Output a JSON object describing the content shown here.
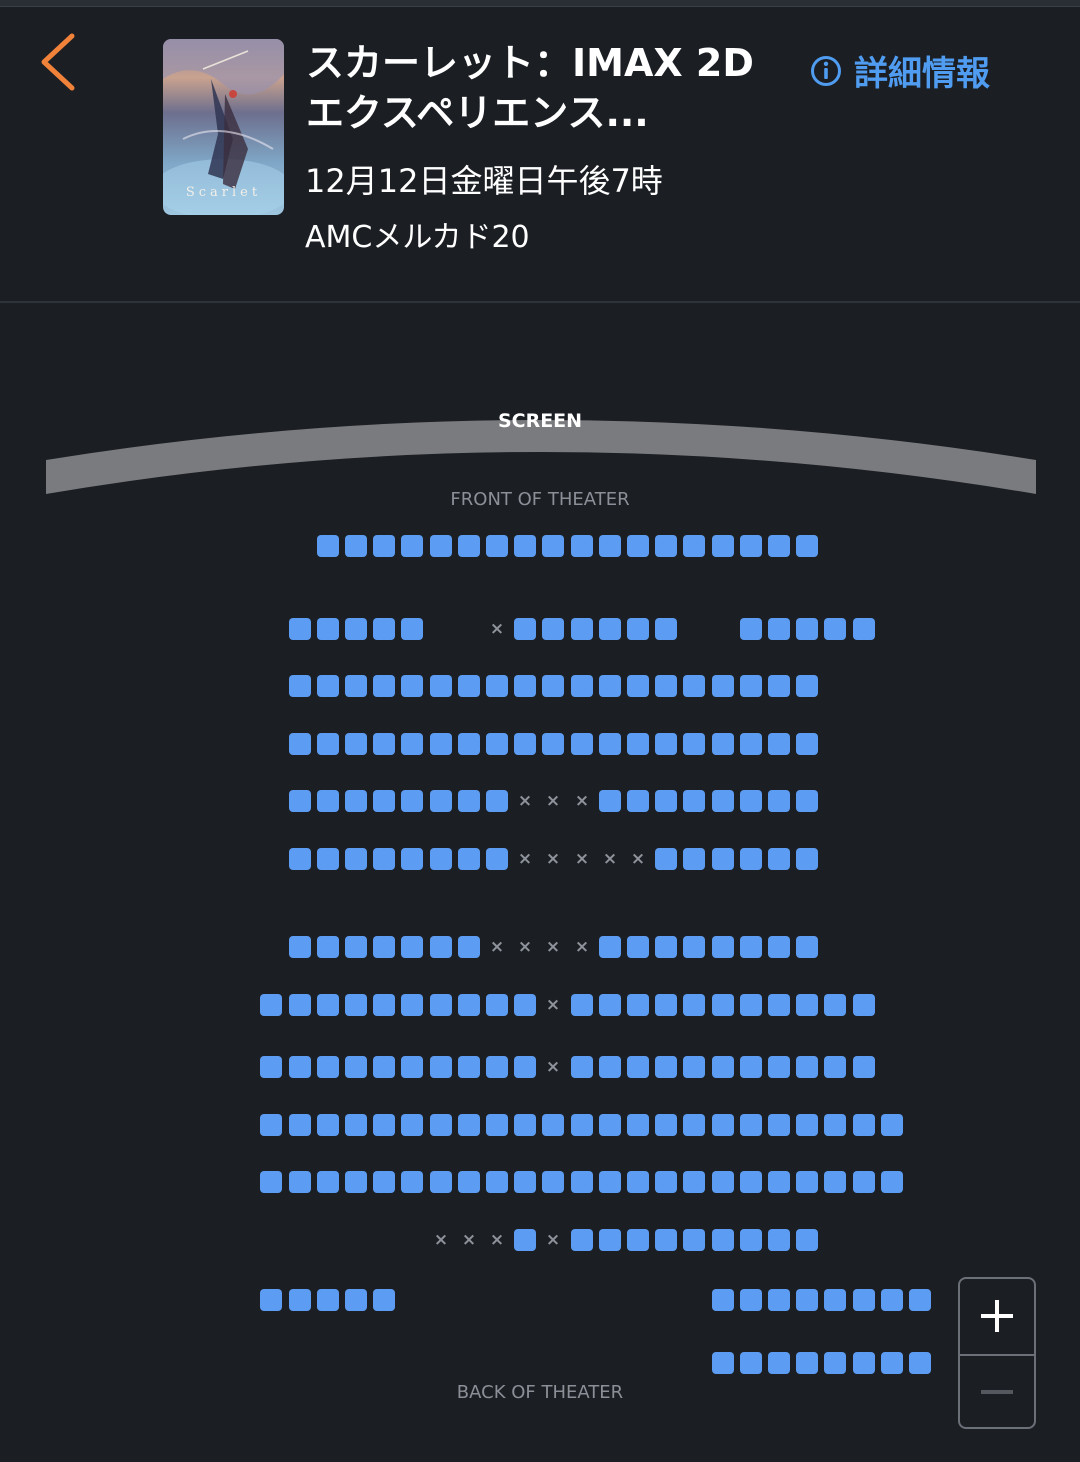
{
  "header": {
    "title_line1": "スカーレット：IMAX 2D",
    "title_line2": "エクスペリエンス...",
    "showtime": "12月12日金曜日午後7時",
    "venue": "AMCメルカド20",
    "details_label": "詳細情報",
    "poster_alt": "Scarlet"
  },
  "auditorium": {
    "screen_label": "SCREEN",
    "front_label": "FRONT OF THEATER",
    "back_label": "BACK OF THEATER",
    "legend": {
      "available": "#5d9cf3",
      "unavailable": "×"
    }
  },
  "seat_rows": [
    "....SSSSSSSSSSSSSSSSSS....",
    "...SSSSS..XSSSSSS..SSSSS..",
    "...SSSSSSSSSSSSSSSSSSS....",
    "...SSSSSSSSSSSSSSSSSSS....",
    "...SSSSSSSSXXXSSSSSSSS....",
    "...SSSSSSSSXXXXXSSSSSS....",
    "...SSSSSSSXXXXSSSSSSSS....",
    "..SSSSSSSSSSXSSSSSSSSSSS..",
    "..SSSSSSSSSSXSSSSSSSSSSS..",
    "..SSSSSSSSSSSSSSSSSSSSSSS.",
    "..SSSSSSSSSSSSSSSSSSSSSSS.",
    "........XXXSXSSSSSSSSS....",
    "..SSSSS...........SSSSSSSS",
    "..................SSSSSSSS"
  ],
  "zoom": {
    "in_icon": "plus-icon",
    "out_icon": "minus-icon"
  }
}
